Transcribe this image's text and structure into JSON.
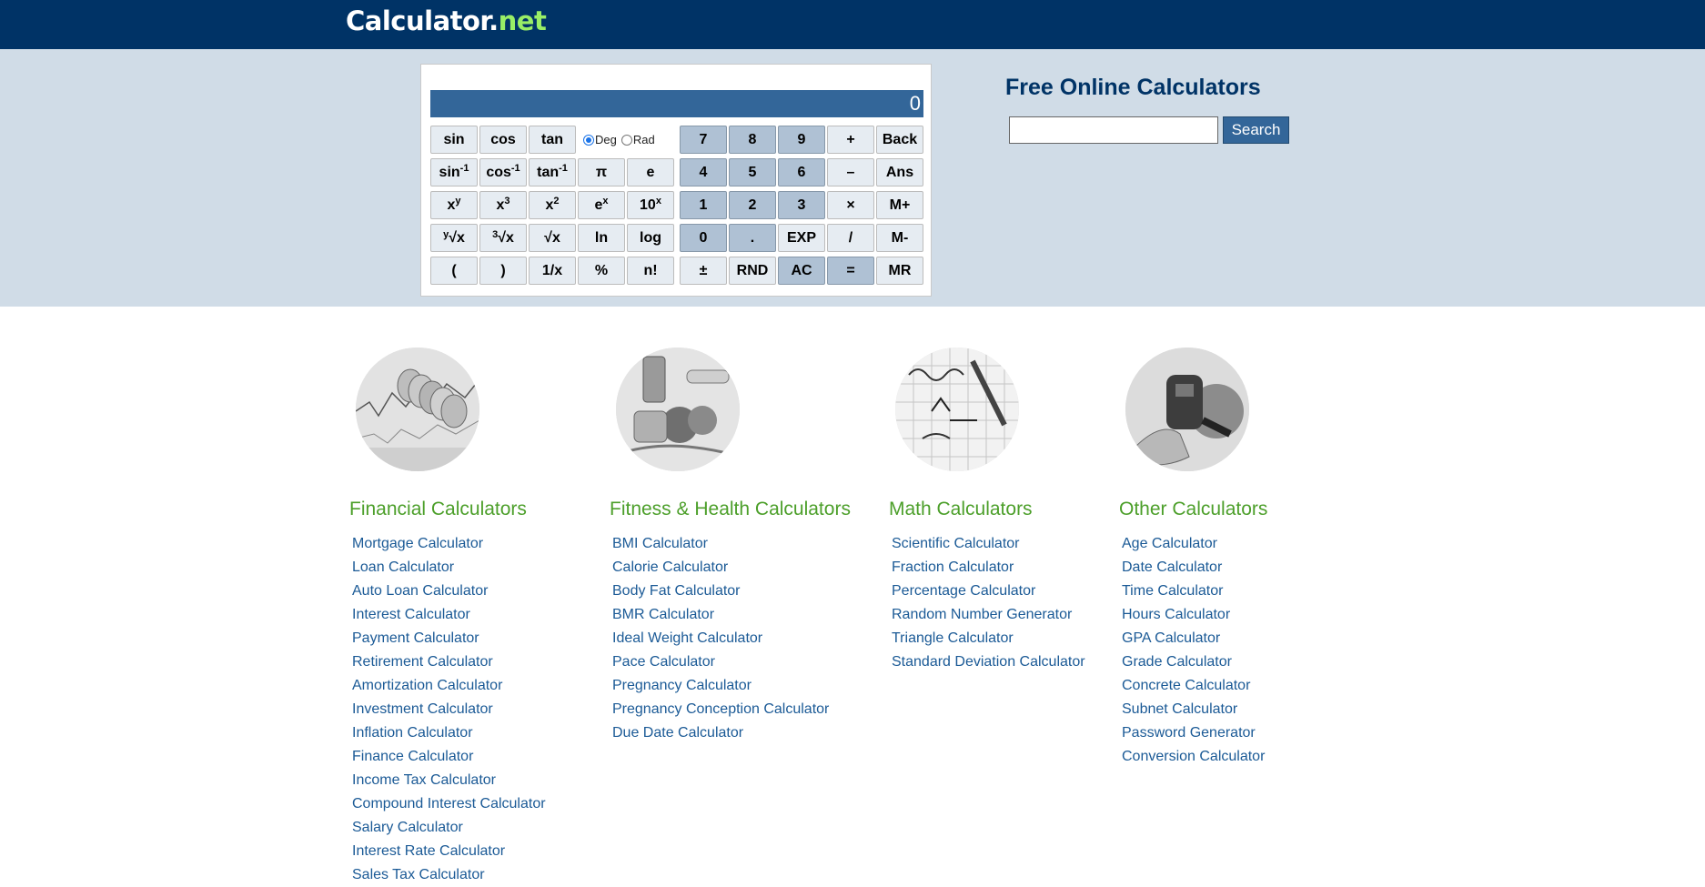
{
  "header": {
    "logo_main": "Calculator",
    "logo_dot": ".",
    "logo_suffix": "net"
  },
  "calculator": {
    "display": "0",
    "angle_modes": [
      "Deg",
      "Rad"
    ],
    "angle_selected": "Deg",
    "keys": {
      "sin": "sin",
      "cos": "cos",
      "tan": "tan",
      "pi": "π",
      "e": "e",
      "ln": "ln",
      "log": "log",
      "paren_open": "(",
      "paren_close": ")",
      "reciprocal": "1/x",
      "percent": "%",
      "factorial": "n!",
      "d7": "7",
      "d8": "8",
      "d9": "9",
      "d4": "4",
      "d5": "5",
      "d6": "6",
      "d1": "1",
      "d2": "2",
      "d3": "3",
      "d0": "0",
      "dot": ".",
      "plus": "+",
      "minus": "–",
      "times": "×",
      "divide": "/",
      "back": "Back",
      "ans": "Ans",
      "mplus": "M+",
      "mminus": "M-",
      "mr": "MR",
      "exp": "EXP",
      "plusminus": "±",
      "rnd": "RND",
      "ac": "AC",
      "equals": "="
    }
  },
  "search": {
    "heading": "Free Online Calculators",
    "button": "Search",
    "placeholder": ""
  },
  "categories": [
    {
      "title": "Financial Calculators",
      "links": [
        "Mortgage Calculator",
        "Loan Calculator",
        "Auto Loan Calculator",
        "Interest Calculator",
        "Payment Calculator",
        "Retirement Calculator",
        "Amortization Calculator",
        "Investment Calculator",
        "Inflation Calculator",
        "Finance Calculator",
        "Income Tax Calculator",
        "Compound Interest Calculator",
        "Salary Calculator",
        "Interest Rate Calculator",
        "Sales Tax Calculator"
      ]
    },
    {
      "title": "Fitness & Health Calculators",
      "links": [
        "BMI Calculator",
        "Calorie Calculator",
        "Body Fat Calculator",
        "BMR Calculator",
        "Ideal Weight Calculator",
        "Pace Calculator",
        "Pregnancy Calculator",
        "Pregnancy Conception Calculator",
        "Due Date Calculator"
      ]
    },
    {
      "title": "Math Calculators",
      "links": [
        "Scientific Calculator",
        "Fraction Calculator",
        "Percentage Calculator",
        "Random Number Generator",
        "Triangle Calculator",
        "Standard Deviation Calculator"
      ]
    },
    {
      "title": "Other Calculators",
      "links": [
        "Age Calculator",
        "Date Calculator",
        "Time Calculator",
        "Hours Calculator",
        "GPA Calculator",
        "Grade Calculator",
        "Concrete Calculator",
        "Subnet Calculator",
        "Password Generator",
        "Conversion Calculator"
      ]
    }
  ],
  "colors": {
    "header_bg": "#003366",
    "hero_bg": "#d0dce7",
    "display_bg": "#336699",
    "category_title": "#4c9f2a",
    "link": "#1b5a96",
    "logo_accent": "#99ee66"
  }
}
